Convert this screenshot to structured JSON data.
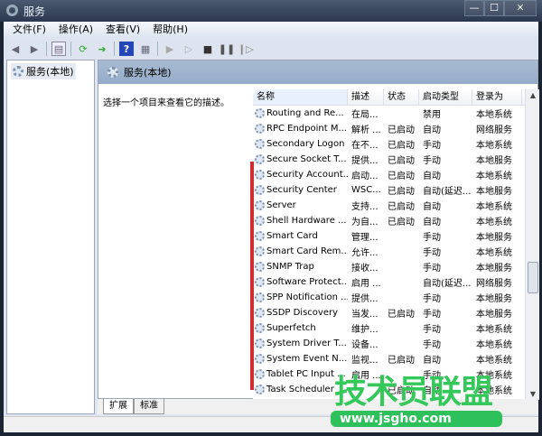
{
  "window": {
    "title": "服务",
    "minimize": "—",
    "maximize": "☐",
    "close": "✕"
  },
  "menu": [
    "文件(F)",
    "操作(A)",
    "查看(V)",
    "帮助(H)"
  ],
  "tree": {
    "root": "服务(本地)"
  },
  "panel": {
    "title": "服务(本地)",
    "description": "选择一个项目来查看它的描述。"
  },
  "columns": [
    "名称",
    "描述",
    "状态",
    "启动类型",
    "登录为"
  ],
  "rows": [
    [
      "Routing and Re...",
      "在局...",
      "",
      "禁用",
      "本地系统"
    ],
    [
      "RPC Endpoint M...",
      "解析 ...",
      "已启动",
      "自动",
      "网络服务"
    ],
    [
      "Secondary Logon",
      "在不...",
      "已启动",
      "手动",
      "本地系统"
    ],
    [
      "Secure Socket T...",
      "提供...",
      "已启动",
      "手动",
      "本地服务"
    ],
    [
      "Security Account...",
      "启动...",
      "已启动",
      "自动",
      "本地系统"
    ],
    [
      "Security Center",
      "WSC...",
      "已启动",
      "自动(延迟...",
      "本地服务"
    ],
    [
      "Server",
      "支持...",
      "已启动",
      "自动",
      "本地系统"
    ],
    [
      "Shell Hardware ...",
      "为自...",
      "已启动",
      "自动",
      "本地系统"
    ],
    [
      "Smart Card",
      "管理...",
      "",
      "手动",
      "本地服务"
    ],
    [
      "Smart Card Rem...",
      "允许...",
      "",
      "手动",
      "本地系统"
    ],
    [
      "SNMP Trap",
      "接收...",
      "",
      "手动",
      "本地服务"
    ],
    [
      "Software Protect...",
      "启用 ...",
      "",
      "自动(延迟...",
      "网络服务"
    ],
    [
      "SPP Notification ...",
      "提供...",
      "",
      "手动",
      "本地服务"
    ],
    [
      "SSDP Discovery",
      "当发...",
      "已启动",
      "手动",
      "本地服务"
    ],
    [
      "Superfetch",
      "维护...",
      "",
      "手动",
      "本地系统"
    ],
    [
      "System Driver T...",
      "设备...",
      "",
      "手动",
      "本地系统"
    ],
    [
      "System Event N...",
      "监视...",
      "已启动",
      "自动",
      "本地系统"
    ],
    [
      "Tablet PC Input ...",
      "启用 ...",
      "",
      "手动",
      "本地系统"
    ],
    [
      "Task Scheduler",
      "",
      "已启动",
      "自动",
      "本地系统"
    ]
  ],
  "tabs": [
    "扩展",
    "标准"
  ],
  "watermark": {
    "text": "技术员联盟",
    "url": "www.jsgho.com"
  },
  "colors": {
    "highlight": "#e0262b",
    "watermark": "#34c759"
  }
}
